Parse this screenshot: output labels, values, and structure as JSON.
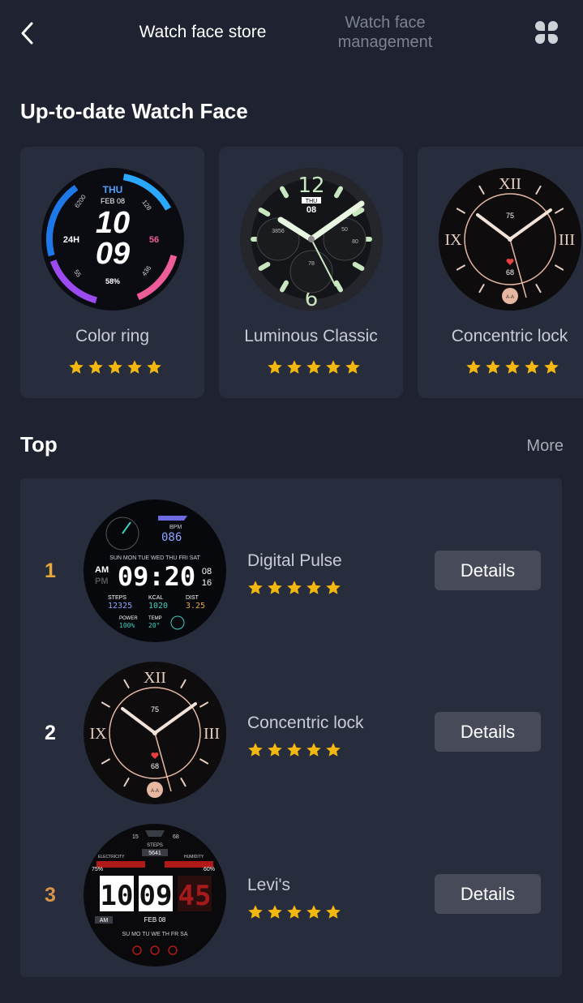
{
  "header": {
    "tab_store": "Watch face store",
    "tab_manage": "Watch face management",
    "back_icon": "chevron-left-icon",
    "grid_icon": "four-petal-grid-icon"
  },
  "latest": {
    "title": "Up-to-date Watch Face",
    "items": [
      {
        "name": "Color ring",
        "rating": 5
      },
      {
        "name": "Luminous Classic",
        "rating": 5
      },
      {
        "name": "Concentric lock",
        "rating": 5
      }
    ]
  },
  "top": {
    "title": "Top",
    "more": "More",
    "items": [
      {
        "rank": "1",
        "name": "Digital Pulse",
        "rating": 5,
        "button": "Details",
        "rank_color": "#e8a83a"
      },
      {
        "rank": "2",
        "name": "Concentric lock",
        "rating": 5,
        "button": "Details",
        "rank_color": "#ffffff"
      },
      {
        "rank": "3",
        "name": "Levi's",
        "rating": 5,
        "button": "Details",
        "rank_color": "#d9944a"
      }
    ]
  },
  "faces": {
    "color_ring": {
      "day": "THU",
      "date": "FEB 08",
      "hour": "10",
      "minute": "09",
      "left": "24H",
      "right": "56",
      "battery": "58%",
      "steps": "6200",
      "hr": "128",
      "c1": "55",
      "c2": "436"
    },
    "luminous": {
      "top_num": "12",
      "bottom_num": "6",
      "day": "THU",
      "date": "08",
      "sub1": "3856",
      "sub2": "50",
      "sub3": "80",
      "sub4": "78"
    },
    "concentric": {
      "n12": "XII",
      "n3": "III",
      "n9": "IX",
      "top": "75",
      "bottom": "68",
      "lock": "A·A"
    },
    "digital_pulse": {
      "bpm_label": "BPM",
      "bpm": "086",
      "days": "SUN MON TUE WED THU FRI SAT",
      "am": "AM",
      "pm": "PM",
      "time": "09:20",
      "date_top": "08",
      "date_bot": "16",
      "steps_label": "STEPS",
      "steps": "12325",
      "kcal_label": "KCAL",
      "kcal": "1020",
      "dist_label": "DIST",
      "dist": "3.25",
      "power_label": "POWER",
      "power": "100%",
      "temp_label": "TEMP",
      "temp": "20°"
    },
    "levis": {
      "s1": "15",
      "s2": "68",
      "steps_label": "STEPS",
      "steps": "5641",
      "elec": "ELECTRICITY",
      "hum": "HUMIDITY",
      "p1": "75%",
      "p2": "60%",
      "h": "10",
      "m": "09",
      "s": "45",
      "am": "AM",
      "date": "FEB 08",
      "days": "SU MO TU WE TH FR SA"
    }
  },
  "colors": {
    "star": "#f5b80f",
    "bg": "#1f2331",
    "card": "#282d3d",
    "button": "#474b59"
  }
}
